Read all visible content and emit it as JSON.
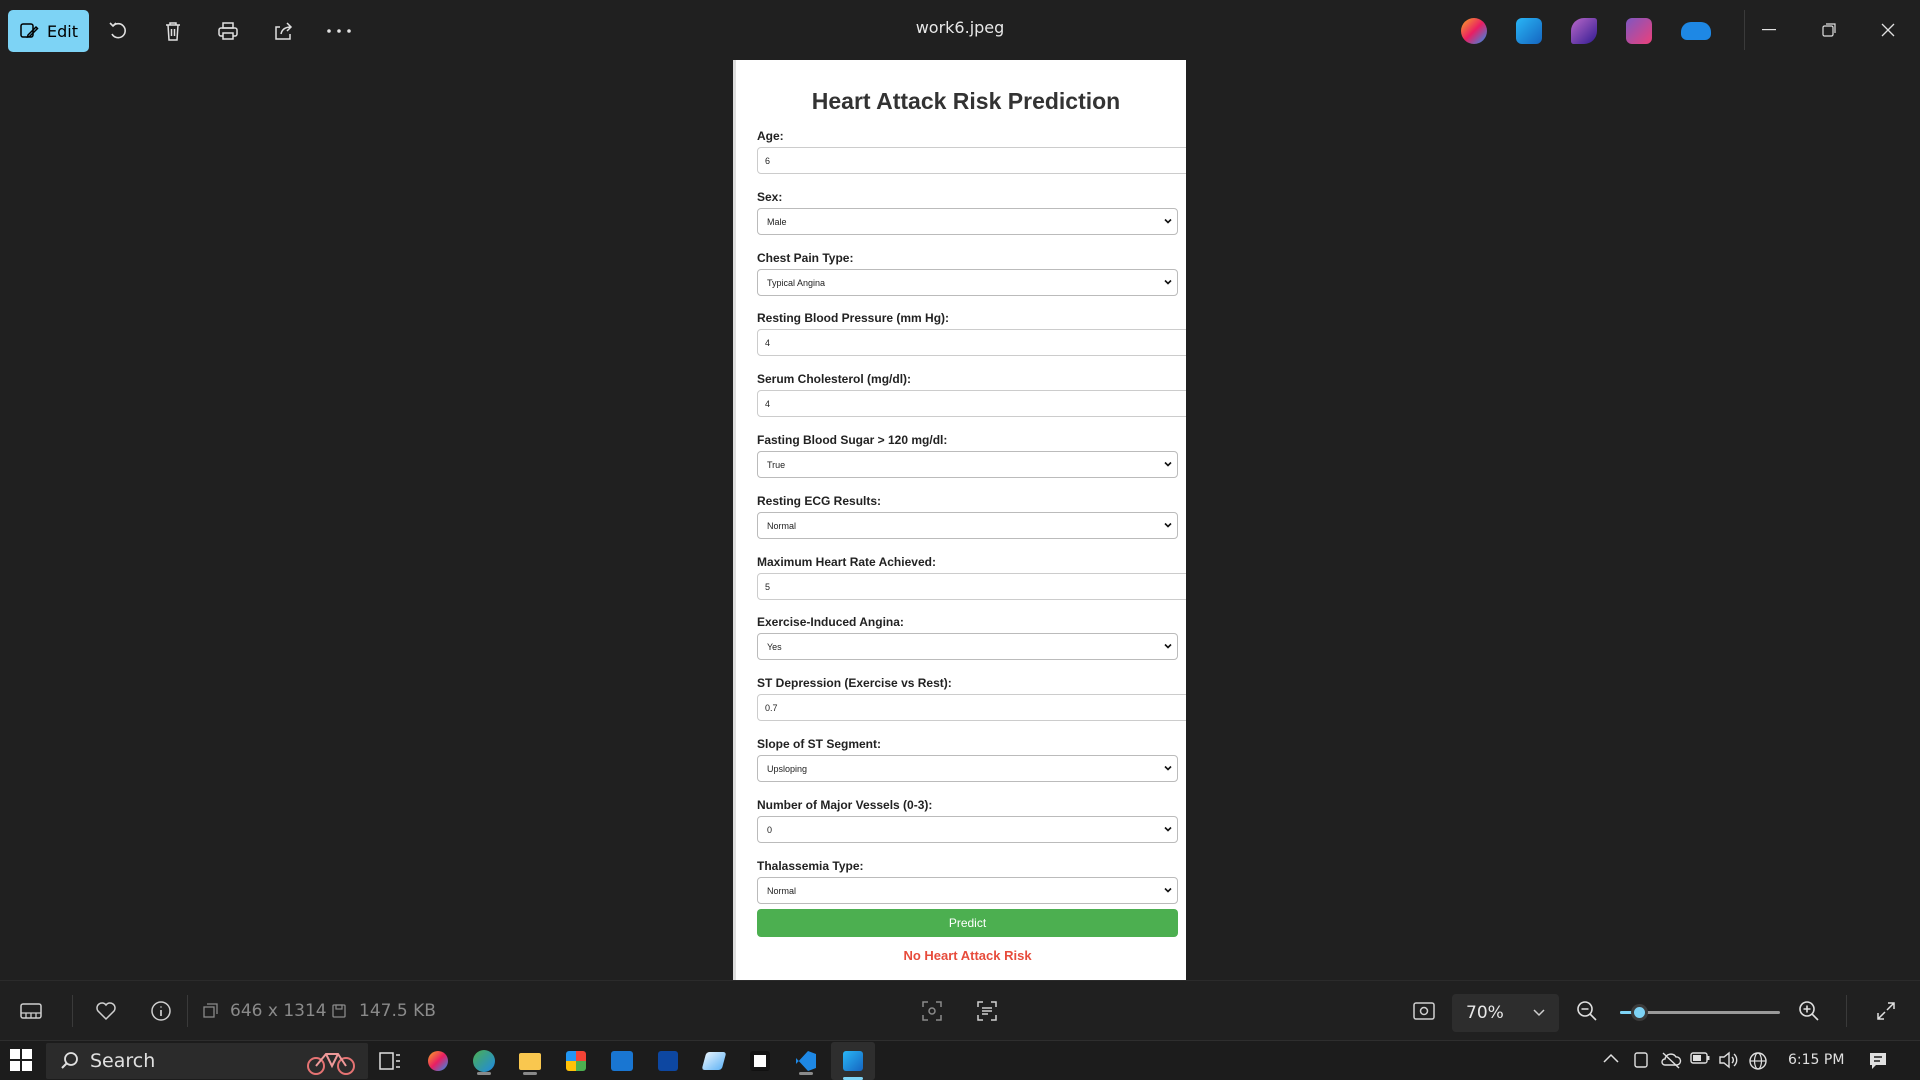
{
  "titlebar": {
    "edit_label": "Edit",
    "title": "work6.jpeg",
    "tools": [
      "rotate-icon",
      "delete-icon",
      "print-icon",
      "share-icon",
      "more-icon"
    ],
    "apps": [
      "copilot-icon",
      "photos-editor-icon",
      "clipchamp-icon",
      "designer-icon",
      "onedrive-icon"
    ]
  },
  "form": {
    "title": "Heart Attack Risk Prediction",
    "fields": [
      {
        "label": "Age:",
        "value": "6",
        "type": "input"
      },
      {
        "label": "Sex:",
        "value": "Male",
        "type": "select"
      },
      {
        "label": "Chest Pain Type:",
        "value": "Typical Angina",
        "type": "select"
      },
      {
        "label": "Resting Blood Pressure (mm Hg):",
        "value": "4",
        "type": "input"
      },
      {
        "label": "Serum Cholesterol (mg/dl):",
        "value": "4",
        "type": "input"
      },
      {
        "label": "Fasting Blood Sugar > 120 mg/dl:",
        "value": "True",
        "type": "select"
      },
      {
        "label": "Resting ECG Results:",
        "value": "Normal",
        "type": "select"
      },
      {
        "label": "Maximum Heart Rate Achieved:",
        "value": "5",
        "type": "input"
      },
      {
        "label": "Exercise-Induced Angina:",
        "value": "Yes",
        "type": "select"
      },
      {
        "label": "ST Depression (Exercise vs Rest):",
        "value": "0.7",
        "type": "input"
      },
      {
        "label": "Slope of ST Segment:",
        "value": "Upsloping",
        "type": "select"
      },
      {
        "label": "Number of Major Vessels (0-3):",
        "value": "0",
        "type": "select"
      },
      {
        "label": "Thalassemia Type:",
        "value": "Normal",
        "type": "select"
      }
    ],
    "predict_label": "Predict",
    "result": "No Heart Attack Risk"
  },
  "statusbar": {
    "dimensions": "646 x 1314",
    "file_size": "147.5 KB",
    "zoom": "70%",
    "zoom_fraction": 0.12
  },
  "taskbar": {
    "search_placeholder": "Search",
    "time": "6:15 PM"
  },
  "colors": {
    "accent": "#7dd3f5",
    "predict_button": "#4caf50",
    "result_text": "#e74c3c"
  }
}
